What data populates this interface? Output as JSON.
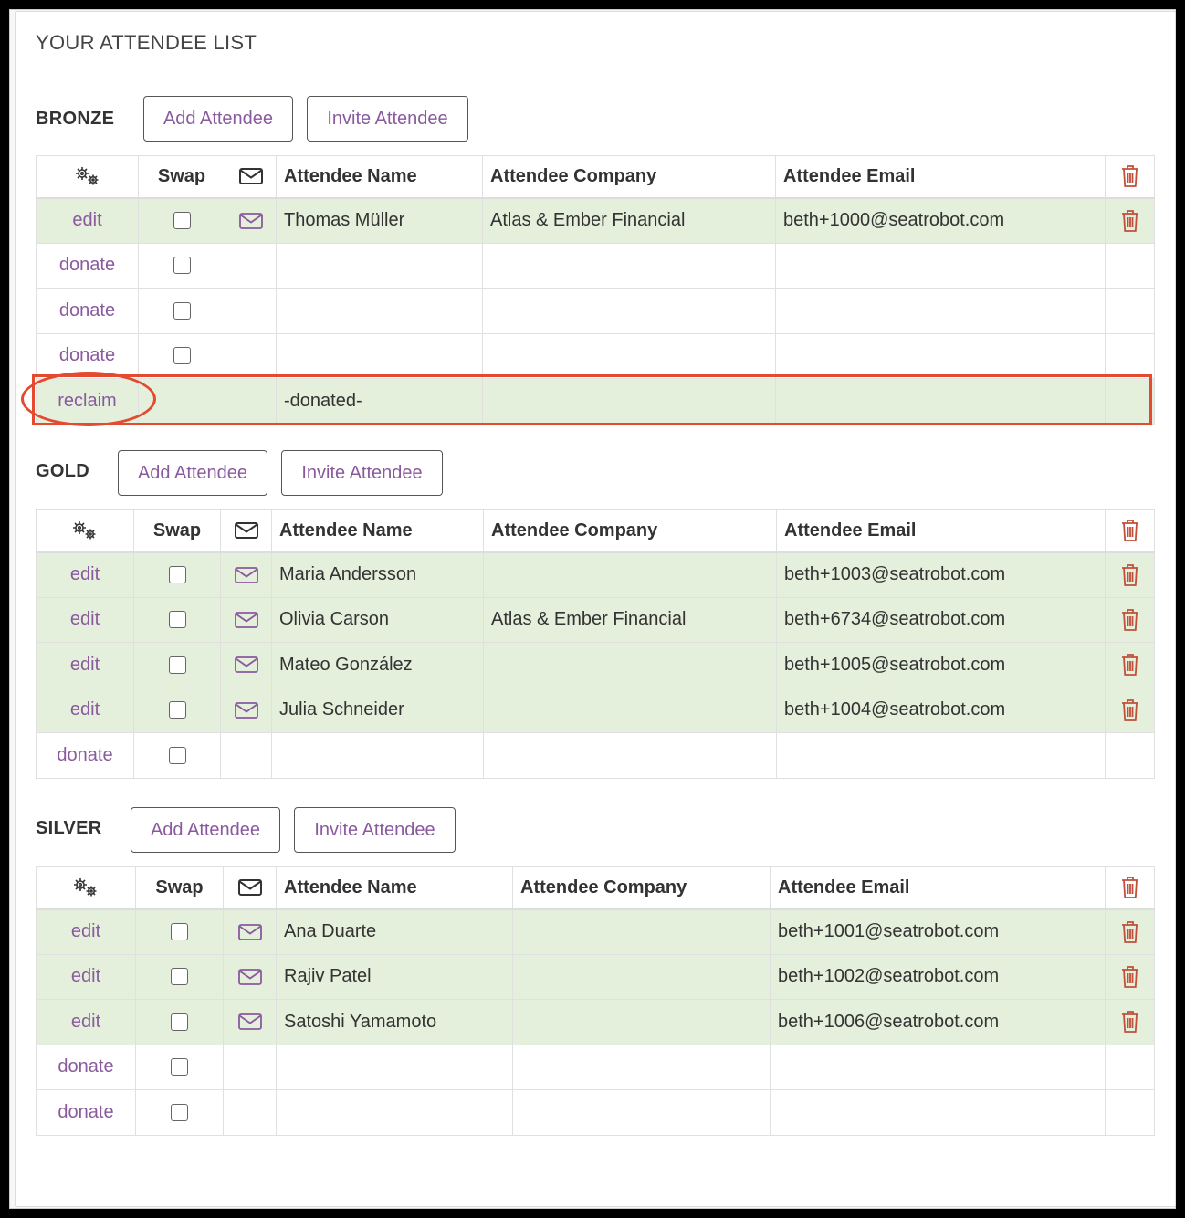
{
  "page": {
    "title": "YOUR ATTENDEE LIST"
  },
  "headers": {
    "swap": "Swap",
    "name": "Attendee Name",
    "company": "Attendee Company",
    "email": "Attendee Email"
  },
  "colors": {
    "accent": "#8a5a9e",
    "filled_row": "#e4efdc",
    "delete_icon": "#c0503a",
    "highlight": "#e34a2f"
  },
  "sections": {
    "bronze": {
      "label": "BRONZE",
      "add_label": "Add Attendee",
      "invite_label": "Invite Attendee",
      "rows": [
        {
          "action": "edit",
          "name": "Thomas Müller",
          "company": "Atlas & Ember Financial",
          "email": "beth+1000@seatrobot.com"
        },
        {
          "action": "donate",
          "name": "",
          "company": "",
          "email": ""
        },
        {
          "action": "donate",
          "name": "",
          "company": "",
          "email": ""
        },
        {
          "action": "donate",
          "name": "",
          "company": "",
          "email": ""
        },
        {
          "action": "reclaim",
          "name": "-donated-",
          "company": "",
          "email": ""
        }
      ]
    },
    "gold": {
      "label": "GOLD",
      "add_label": "Add Attendee",
      "invite_label": "Invite Attendee",
      "rows": [
        {
          "action": "edit",
          "name": "Maria Andersson",
          "company": "",
          "email": "beth+1003@seatrobot.com"
        },
        {
          "action": "edit",
          "name": "Olivia Carson",
          "company": "Atlas & Ember Financial",
          "email": "beth+6734@seatrobot.com"
        },
        {
          "action": "edit",
          "name": "Mateo González",
          "company": "",
          "email": "beth+1005@seatrobot.com"
        },
        {
          "action": "edit",
          "name": "Julia Schneider",
          "company": "",
          "email": "beth+1004@seatrobot.com"
        },
        {
          "action": "donate",
          "name": "",
          "company": "",
          "email": ""
        }
      ]
    },
    "silver": {
      "label": "SILVER",
      "add_label": "Add Attendee",
      "invite_label": "Invite Attendee",
      "rows": [
        {
          "action": "edit",
          "name": "Ana Duarte",
          "company": "",
          "email": "beth+1001@seatrobot.com"
        },
        {
          "action": "edit",
          "name": "Rajiv Patel",
          "company": "",
          "email": "beth+1002@seatrobot.com"
        },
        {
          "action": "edit",
          "name": "Satoshi Yamamoto",
          "company": "",
          "email": "beth+1006@seatrobot.com"
        },
        {
          "action": "donate",
          "name": "",
          "company": "",
          "email": ""
        },
        {
          "action": "donate",
          "name": "",
          "company": "",
          "email": ""
        }
      ]
    }
  }
}
